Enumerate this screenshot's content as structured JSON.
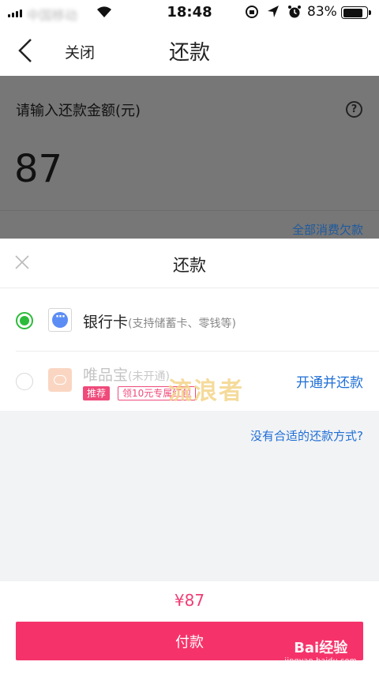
{
  "status_bar": {
    "carrier": "中国移动",
    "time": "18:48",
    "battery": "83%",
    "battery_level": 0.83
  },
  "nav": {
    "close_label": "关闭",
    "title": "还款"
  },
  "form": {
    "amount_prompt": "请输入还款金额(元)",
    "help_glyph": "?",
    "amount": "87",
    "all_debt_label": "全部消费欠款"
  },
  "sheet": {
    "title": "还款",
    "methods": [
      {
        "name": "银行卡",
        "note": "(支持储蓄卡、零钱等)",
        "selected": true
      },
      {
        "name": "唯品宝",
        "note": "(未开通)",
        "tag": "推荐",
        "coupon": "领10元专属红包",
        "action": "开通并还款",
        "selected": false
      }
    ],
    "watermark": "流浪者"
  },
  "no_method_link": "没有合适的还款方式?",
  "footer": {
    "total": "¥87",
    "pay_label": "付款",
    "baidu_brand": "Bai经验",
    "baidu_url": "jingyan.baidu.com"
  },
  "colors": {
    "accent": "#f5336a",
    "link": "#1e6ed6",
    "selected": "#2cbb3a"
  }
}
